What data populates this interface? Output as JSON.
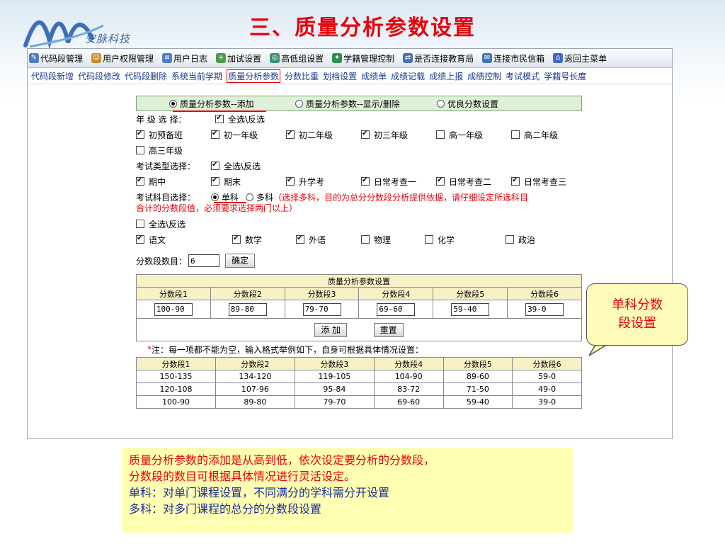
{
  "slide": {
    "title": "三、质量分析参数设置",
    "logo_text": "安脉科技"
  },
  "menubar": [
    {
      "label": "代码段管理",
      "icon": "wrench-icon",
      "color": "#4d7fbf"
    },
    {
      "label": "用户权限管理",
      "icon": "users-icon",
      "color": "#c8892d"
    },
    {
      "label": "用户日志",
      "icon": "log-icon",
      "color": "#4a7cc7"
    },
    {
      "label": "加试设置",
      "icon": "add-icon",
      "color": "#4a9d4a"
    },
    {
      "label": "高低组设置",
      "icon": "group-icon",
      "color": "#3b8f6f"
    },
    {
      "label": "学籍管理控制",
      "icon": "record-icon",
      "color": "#2d8f4e"
    },
    {
      "label": "是否连接教育局",
      "icon": "network-icon",
      "color": "#4d6fb5"
    },
    {
      "label": "连接市民信箱",
      "icon": "mail-icon",
      "color": "#3f75b8"
    },
    {
      "label": "返回主菜单",
      "icon": "home-icon",
      "color": "#4169c2"
    }
  ],
  "submenu": [
    "代码段新增",
    "代码段修改",
    "代码段删除",
    "系统当前学期",
    "质量分析参数",
    "分数比重",
    "划档设置",
    "成绩单",
    "成绩记载",
    "成绩上报",
    "成绩控制",
    "考试模式",
    "学籍号长度"
  ],
  "submenu_active_index": 4,
  "tabs": [
    {
      "label": "质量分析参数--添加",
      "selected": true
    },
    {
      "label": "质量分析参数--显示/删除",
      "selected": false
    },
    {
      "label": "优良分数设置",
      "selected": false
    }
  ],
  "grade": {
    "label": "年 级 选 择：",
    "select_all": "全选\\反选",
    "items": [
      "初预备班",
      "初一年级",
      "初二年级",
      "初三年级",
      "高一年级",
      "高二年级",
      "高三年级"
    ],
    "checked": [
      true,
      true,
      true,
      true,
      false,
      false,
      false
    ]
  },
  "exam_type": {
    "label": "考试类型选择：",
    "select_all": "全选\\反选",
    "items": [
      "期中",
      "期末",
      "升学考",
      "日常考查一",
      "日常考查二",
      "日常考查三"
    ],
    "checked": [
      true,
      true,
      true,
      true,
      true,
      true
    ]
  },
  "subject_mode": {
    "label": "考试科目选择：",
    "single": "单科",
    "multi": "多科",
    "note_line1": "（选择多科，目的为总分分数段分析提供依据，请仔细设定所选科目",
    "note_line2": "合计的分数段值，必须要求选择两门以上）"
  },
  "subjects": {
    "select_all": "全选\\反选",
    "items": [
      "语文",
      "数学",
      "外语",
      "物理",
      "化学",
      "政治"
    ],
    "checked": [
      true,
      true,
      true,
      false,
      false,
      false
    ]
  },
  "segment_count": {
    "label": "分数段数目：",
    "value": "6",
    "confirm": "确定"
  },
  "param_table": {
    "title": "质量分析参数设置",
    "headers": [
      "分数段1",
      "分数段2",
      "分数段3",
      "分数段4",
      "分数段5",
      "分数段6"
    ],
    "values": [
      "100-90",
      "89-80",
      "79-70",
      "69-60",
      "59-40",
      "39-0"
    ],
    "add": "添 加",
    "reset": "重置"
  },
  "example": {
    "star": "*",
    "note": "注：每一项都不能为空，输入格式举例如下，自身可根据具体情况设置：",
    "headers": [
      "分数段1",
      "分数段2",
      "分数段3",
      "分数段4",
      "分数段5",
      "分数段6"
    ],
    "rows": [
      [
        "150-135",
        "134-120",
        "119-105",
        "104-90",
        "89-60",
        "59-0"
      ],
      [
        "120-108",
        "107-96",
        "95-84",
        "83-72",
        "71-50",
        "49-0"
      ],
      [
        "100-90",
        "89-80",
        "79-70",
        "69-60",
        "59-40",
        "39-0"
      ]
    ]
  },
  "callout": {
    "line1": "单科分数",
    "line2": "段设置"
  },
  "description": {
    "line1": "质量分析参数的添加是从高到低，依次设定要分析的分数段，",
    "line2": "分数段的数目可根据具体情况进行灵活设定。",
    "line3": "单科：对单门课程设置，不同满分的学科需分开设置",
    "line4": "多科：对多门课程的总分的分数段设置"
  }
}
